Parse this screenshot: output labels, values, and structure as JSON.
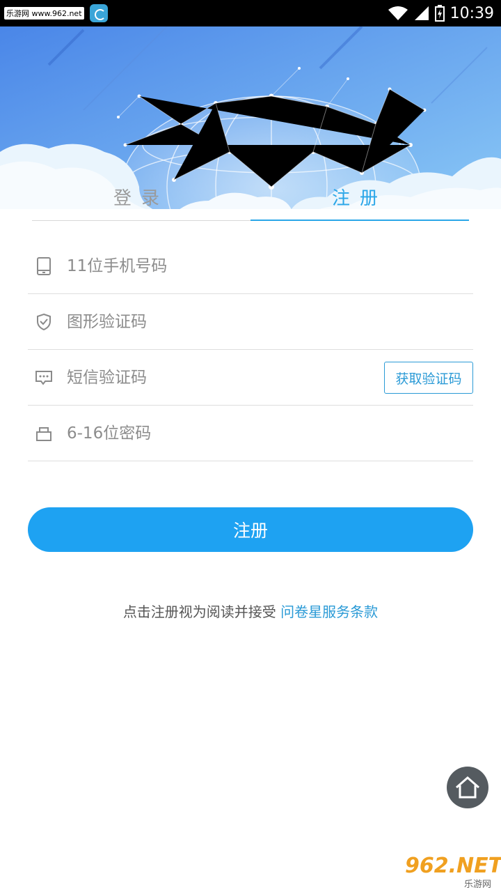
{
  "status_bar": {
    "watermark": "乐游网 www.962.net",
    "time": "10:39"
  },
  "tabs": {
    "login": "登录",
    "register": "注册",
    "active": "register"
  },
  "form": {
    "phone_placeholder": "11位手机号码",
    "captcha_placeholder": "图形验证码",
    "sms_placeholder": "短信验证码",
    "get_code_label": "获取验证码",
    "password_placeholder": "6-16位密码"
  },
  "submit_label": "注册",
  "terms": {
    "prefix": "点击注册视为阅读并接受 ",
    "link": "问卷星服务条款"
  },
  "watermark_badge": {
    "brand": "962.NET",
    "sub": "乐游网"
  },
  "colors": {
    "accent": "#1ea2f2",
    "tab_active": "#2aa6e8",
    "hero_top": "#4f8fea",
    "hero_bottom": "#7fc0f4"
  }
}
